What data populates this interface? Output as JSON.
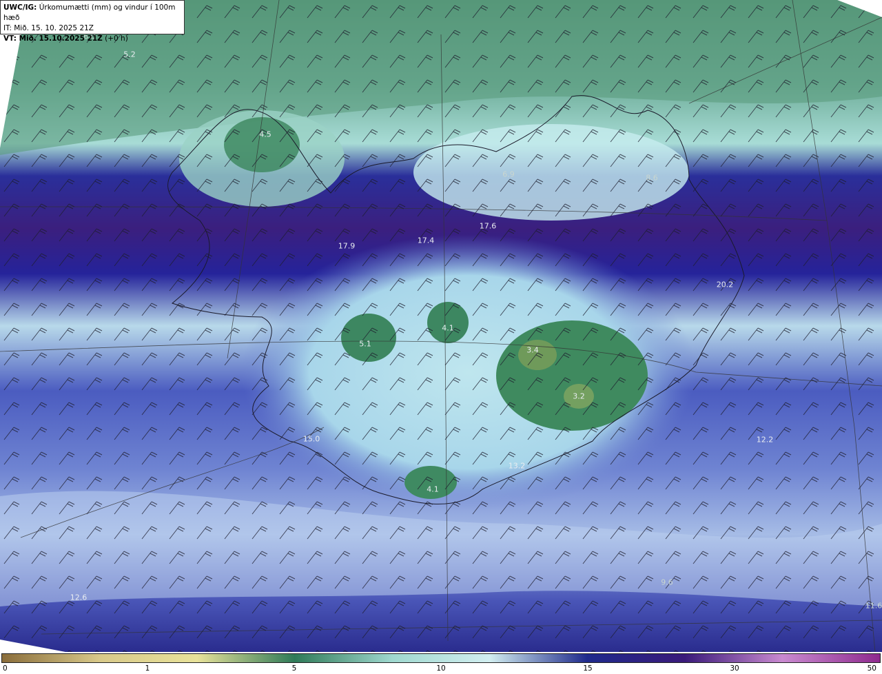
{
  "title": {
    "product": "UWC/IG:",
    "description": "Úrkomumætti (mm) og vindur í 100m hæð",
    "init_time": "IT: Mið. 15. 10. 2025 21Z",
    "valid_prefix": "VT: Mið. 15.10.2025 21Z",
    "valid_offset": "(+0 h)"
  },
  "value_labels": [
    {
      "text": "6.0"
    },
    {
      "text": "5.2"
    },
    {
      "text": "4.5"
    },
    {
      "text": "17.9"
    },
    {
      "text": "17.4"
    },
    {
      "text": "17.6"
    },
    {
      "text": "6.9"
    },
    {
      "text": "8.6"
    },
    {
      "text": "20.2"
    },
    {
      "text": "4.1"
    },
    {
      "text": "5.1"
    },
    {
      "text": "3.4"
    },
    {
      "text": "3.2"
    },
    {
      "text": "15.0"
    },
    {
      "text": "12.2"
    },
    {
      "text": "13.2"
    },
    {
      "text": "4.1"
    },
    {
      "text": "12.6"
    },
    {
      "text": "9.6"
    },
    {
      "text": "11.6"
    }
  ],
  "colorbar": {
    "ticks": [
      "0",
      "1",
      "5",
      "10",
      "15",
      "30",
      "50"
    ],
    "colors": [
      "#8a6d3b",
      "#d8c98a",
      "#e8e29a",
      "#2f7a58",
      "#9fd8cf",
      "#d2eef0",
      "#1f2a8c",
      "#3a1a7a",
      "#c98ad0",
      "#8e2a8e"
    ]
  }
}
